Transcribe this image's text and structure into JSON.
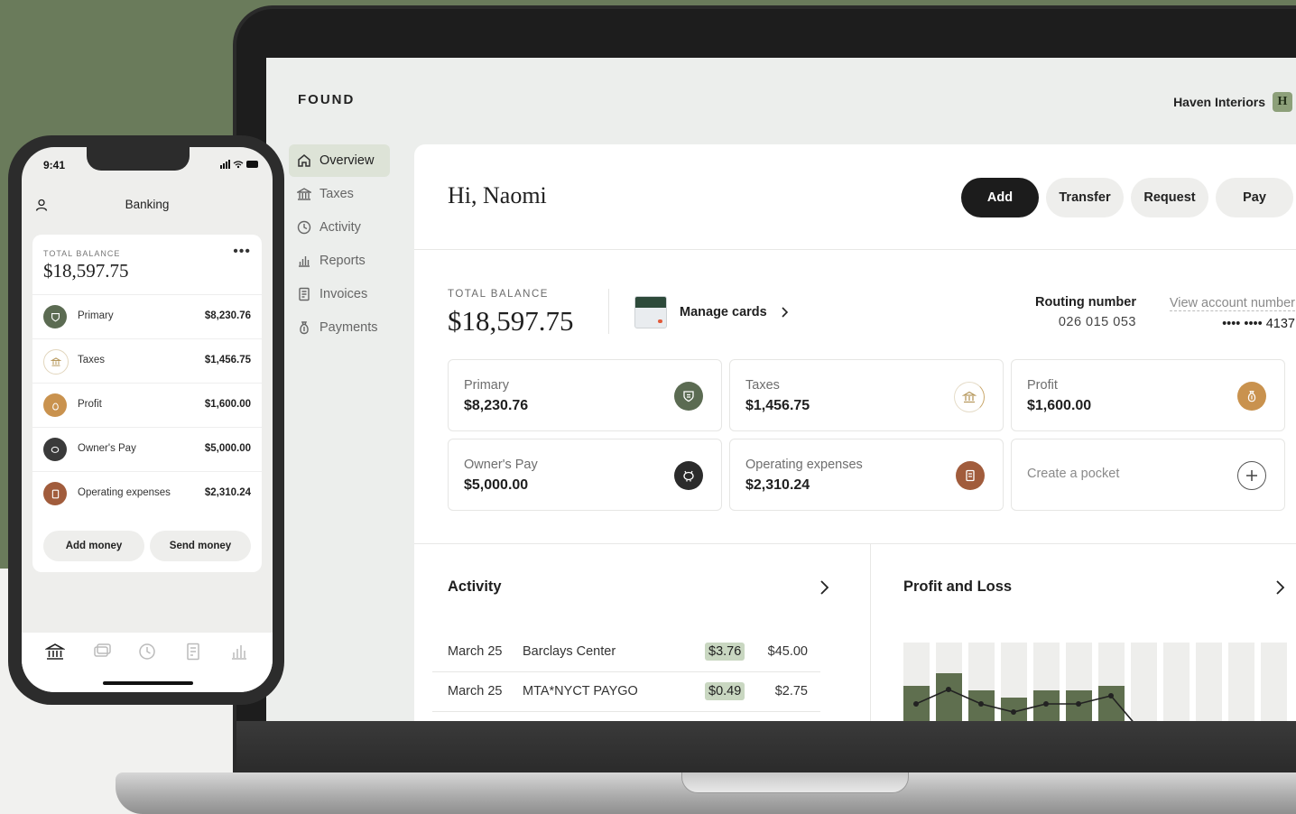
{
  "app": {
    "logo": "FOUND",
    "org_name": "Haven Interiors",
    "org_initial": "H"
  },
  "nav": [
    {
      "label": "Overview",
      "icon": "home-icon",
      "active": true
    },
    {
      "label": "Taxes",
      "icon": "bank-icon"
    },
    {
      "label": "Activity",
      "icon": "clock-icon"
    },
    {
      "label": "Reports",
      "icon": "bar-chart-icon"
    },
    {
      "label": "Invoices",
      "icon": "document-icon"
    },
    {
      "label": "Payments",
      "icon": "money-bag-icon"
    }
  ],
  "header": {
    "greeting": "Hi, Naomi",
    "actions": {
      "add": "Add",
      "transfer": "Transfer",
      "request": "Request",
      "pay": "Pay"
    }
  },
  "balance": {
    "label": "TOTAL BALANCE",
    "amount": "$18,597.75",
    "manage_cards": "Manage cards",
    "routing_label": "Routing number",
    "routing_number": "026 015 053",
    "account_link": "View account number",
    "account_masked": "•••• •••• 4137"
  },
  "pockets": [
    {
      "name": "Primary",
      "amount": "$8,230.76",
      "icon": "shield-icon",
      "color": "#5b6b52"
    },
    {
      "name": "Taxes",
      "amount": "$1,456.75",
      "icon": "bank-icon",
      "color": "#ffffff"
    },
    {
      "name": "Profit",
      "amount": "$1,600.00",
      "icon": "money-bag-icon",
      "color": "#c9924e"
    },
    {
      "name": "Owner's Pay",
      "amount": "$5,000.00",
      "icon": "pig-icon",
      "color": "#2b2b2b"
    },
    {
      "name": "Operating expenses",
      "amount": "$2,310.24",
      "icon": "receipt-icon",
      "color": "#a15c3c"
    }
  ],
  "create_pocket": "Create a pocket",
  "activity": {
    "title": "Activity",
    "rows": [
      {
        "date": "March 25",
        "merchant": "Barclays Center",
        "roundup": "$3.76",
        "amount": "$45.00"
      },
      {
        "date": "March 25",
        "merchant": "MTA*NYCT PAYGO",
        "roundup": "$0.49",
        "amount": "$2.75"
      }
    ]
  },
  "pnl": {
    "title": "Profit and Loss"
  },
  "colors": {
    "accent_green": "#5f6f4f",
    "chip_green": "#c9d7c1",
    "background_green": "#6a7b5b"
  },
  "phone": {
    "time": "9:41",
    "title": "Banking",
    "balance_label": "TOTAL BALANCE",
    "balance_amount": "$18,597.75",
    "menu": "•••",
    "rows": [
      {
        "name": "Primary",
        "amount": "$8,230.76"
      },
      {
        "name": "Taxes",
        "amount": "$1,456.75"
      },
      {
        "name": "Profit",
        "amount": "$1,600.00"
      },
      {
        "name": "Owner's Pay",
        "amount": "$5,000.00"
      },
      {
        "name": "Operating expenses",
        "amount": "$2,310.24"
      }
    ],
    "add_money": "Add money",
    "send_money": "Send money"
  }
}
